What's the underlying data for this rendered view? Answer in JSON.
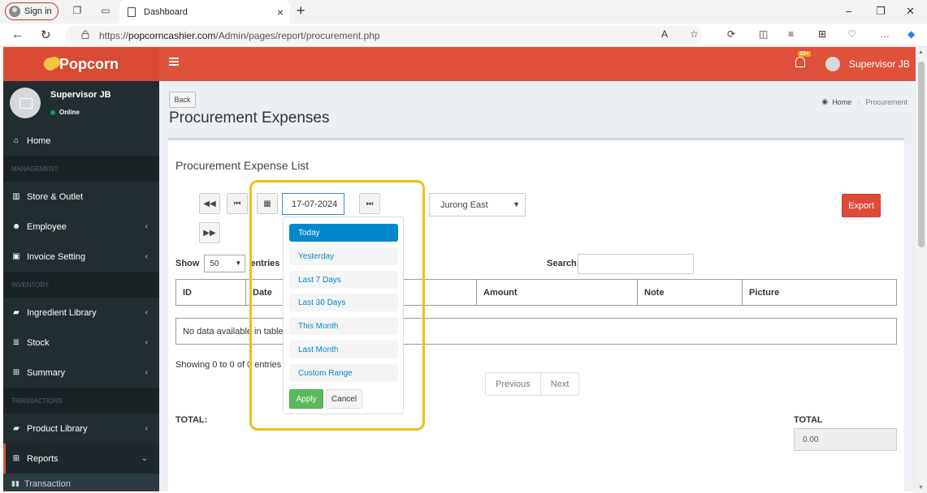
{
  "browser": {
    "sign_in": "Sign in",
    "tab_title": "Dashboard",
    "url_prefix": "https://",
    "url_host": "popcorncashier.com",
    "url_path": "/Admin/pages/report/procurement.php"
  },
  "header": {
    "brand": "Popcorn",
    "notification_badge": "10+",
    "user_name": "Supervisor JB"
  },
  "sidebar": {
    "user_name": "Supervisor JB",
    "user_status": "Online",
    "home": "Home",
    "sections": {
      "management": "MANAGEMENT",
      "inventory": "INVENTORY",
      "transactions": "TRANSACTIONS"
    },
    "items": {
      "store_outlet": "Store & Outlet",
      "employee": "Employee",
      "invoice_setting": "Invoice Setting",
      "ingredient_library": "Ingredient Library",
      "stock": "Stock",
      "summary": "Summary",
      "product_library": "Product Library",
      "reports": "Reports",
      "transaction": "Transaction"
    }
  },
  "page": {
    "back_label": "Back",
    "title": "Procurement Expenses",
    "breadcrumb": {
      "home": "Home",
      "current": "Procurement"
    }
  },
  "list": {
    "title": "Procurement Expense List",
    "date_value": "17-07-2024",
    "outlet_value": "Jurong East",
    "export_label": "Export",
    "show_label": "Show",
    "page_length": "50",
    "entries_label": "entries",
    "search_label": "Search:",
    "columns": [
      "ID",
      "Date",
      "",
      "Amount",
      "Note",
      "Picture"
    ],
    "empty_message": "No data available in table",
    "info": "Showing 0 to 0 of 0 entries",
    "prev_label": "Previous",
    "next_label": "Next",
    "total_left": "TOTAL:",
    "total_right": "TOTAL",
    "total_value": "0.00"
  },
  "daterange": {
    "ranges": [
      "Today",
      "Yesterday",
      "Last 7 Days",
      "Last 30 Days",
      "This Month",
      "Last Month",
      "Custom Range"
    ],
    "selected_index": 0,
    "apply_label": "Apply",
    "cancel_label": "Cancel"
  },
  "colors": {
    "header": "#e0513b",
    "sidebar": "#222d32",
    "export": "#dd4b39",
    "range_active": "#0088cc",
    "apply": "#5cb85c",
    "highlight": "#f0bf1a"
  }
}
